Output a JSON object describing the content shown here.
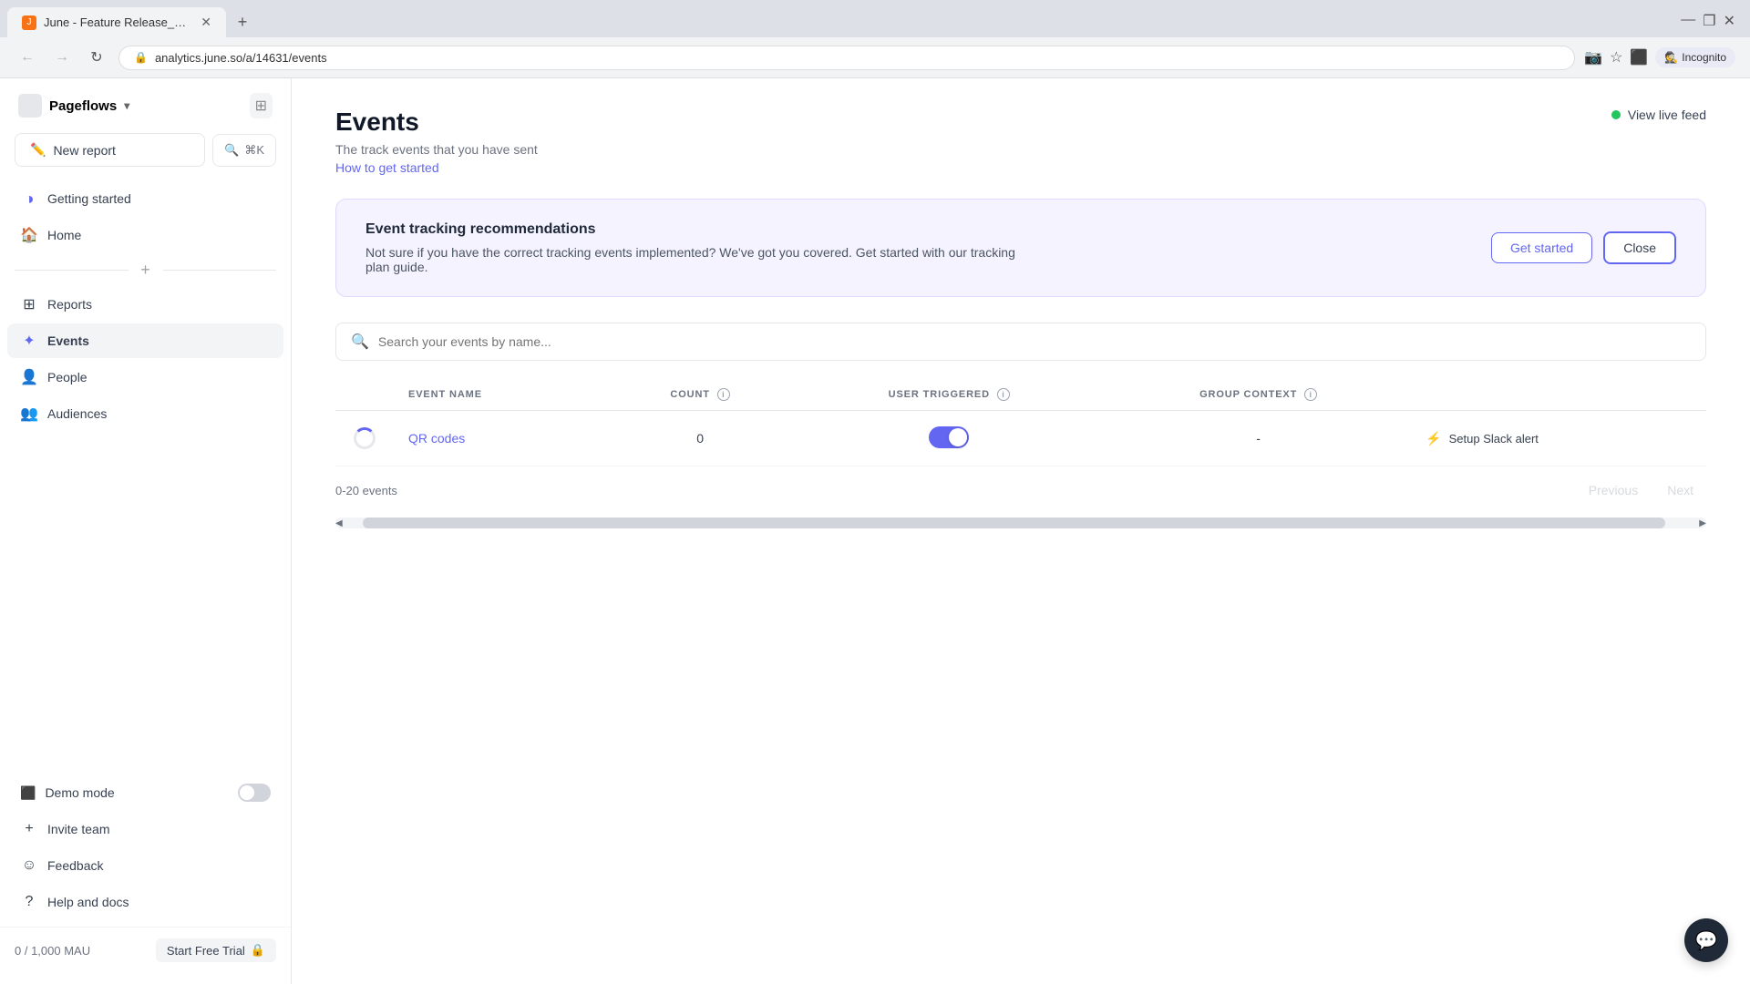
{
  "browser": {
    "tab_title": "June - Feature Release_QR Code...",
    "url": "analytics.june.so/a/14631/events",
    "incognito_label": "Incognito"
  },
  "sidebar": {
    "logo": "Pageflows",
    "new_report_label": "New report",
    "search_label": "⌘K",
    "nav_items": [
      {
        "id": "getting-started",
        "label": "Getting started",
        "icon": "○"
      },
      {
        "id": "home",
        "label": "Home",
        "icon": "⌂"
      },
      {
        "id": "reports",
        "label": "Reports",
        "icon": "⊞"
      },
      {
        "id": "events",
        "label": "Events",
        "icon": "✦",
        "active": true
      },
      {
        "id": "people",
        "label": "People",
        "icon": "👤"
      },
      {
        "id": "audiences",
        "label": "Audiences",
        "icon": "👥"
      }
    ],
    "bottom_items": [
      {
        "id": "demo-mode",
        "label": "Demo mode",
        "has_toggle": true
      },
      {
        "id": "invite-team",
        "label": "Invite team",
        "icon": "+"
      },
      {
        "id": "feedback",
        "label": "Feedback",
        "icon": "☺"
      },
      {
        "id": "help-docs",
        "label": "Help and docs",
        "icon": "?"
      }
    ],
    "mau": "0 / 1,000 MAU",
    "free_trial": "Start Free Trial"
  },
  "main": {
    "title": "Events",
    "subtitle": "The track events that you have sent",
    "link_text": "How to get started",
    "live_feed_label": "View live feed",
    "banner": {
      "title": "Event tracking recommendations",
      "description": "Not sure if you have the correct tracking events implemented? We've got you covered. Get started with our tracking plan guide.",
      "get_started_label": "Get started",
      "close_label": "Close"
    },
    "search_placeholder": "Search your events by name...",
    "table": {
      "columns": [
        {
          "id": "event-name",
          "label": "EVENT NAME"
        },
        {
          "id": "count",
          "label": "COUNT"
        },
        {
          "id": "user-triggered",
          "label": "USER TRIGGERED"
        },
        {
          "id": "group-context",
          "label": "GROUP CONTEXT"
        }
      ],
      "rows": [
        {
          "name": "QR codes",
          "count": "0",
          "user_triggered": true,
          "group_context": "-",
          "has_slack": true
        }
      ],
      "setup_slack_label": "Setup Slack alert",
      "events_count": "0-20 events",
      "previous_label": "Previous",
      "next_label": "Next"
    }
  }
}
